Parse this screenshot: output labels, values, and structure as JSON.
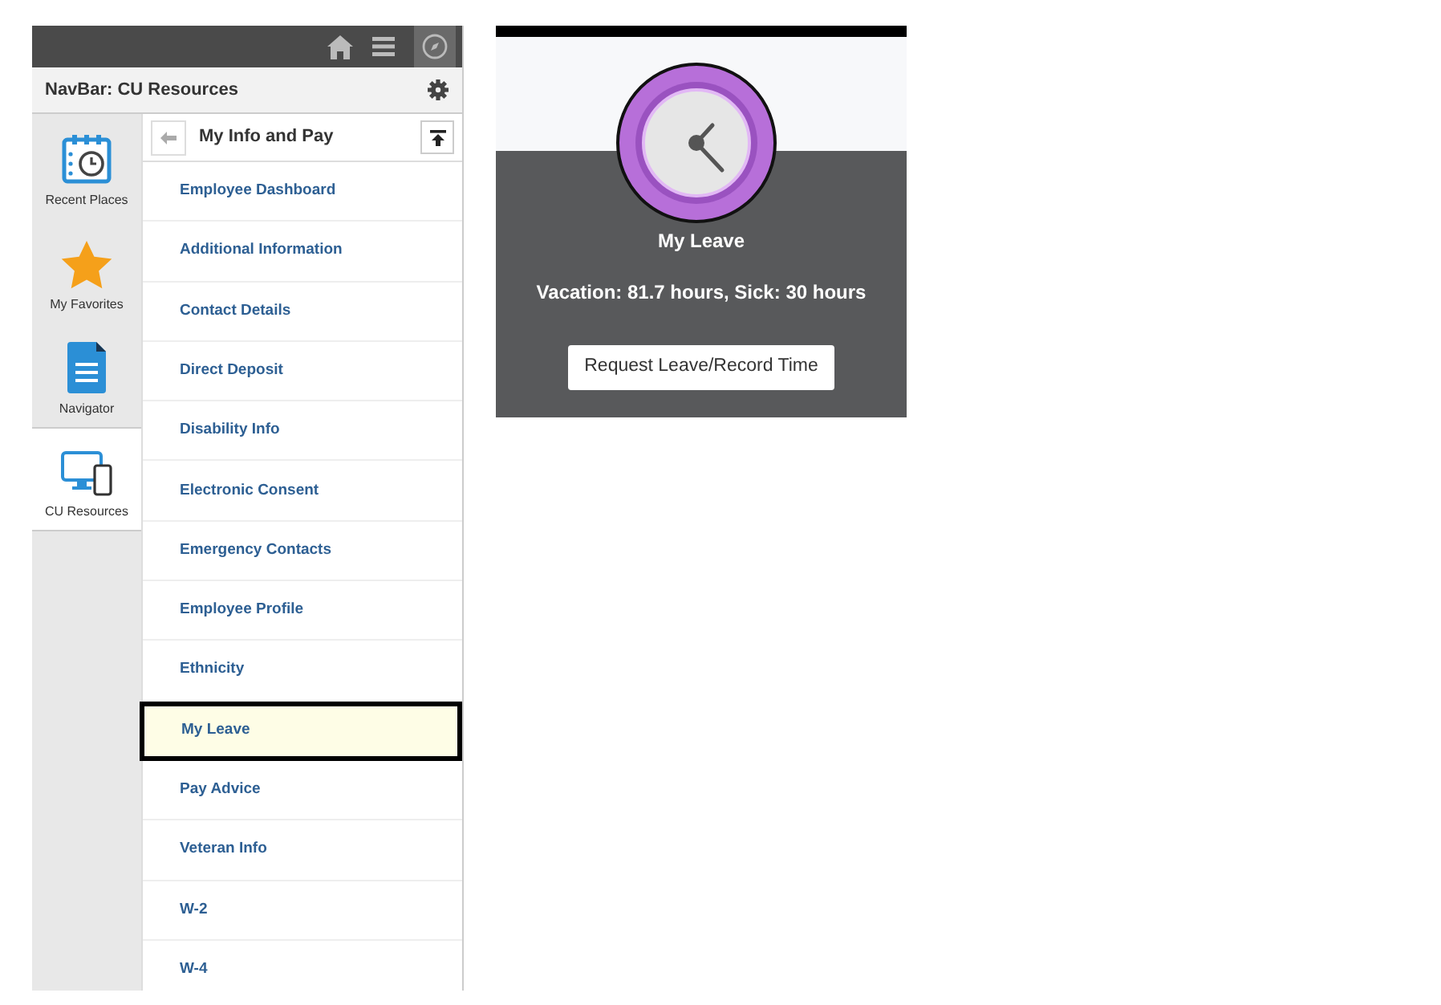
{
  "navbar": {
    "title": "NavBar: CU Resources"
  },
  "rail": [
    {
      "label": "Recent Places",
      "kind": "recent",
      "selected": false
    },
    {
      "label": "My Favorites",
      "kind": "favorites",
      "selected": false
    },
    {
      "label": "Navigator",
      "kind": "navigator",
      "selected": false
    },
    {
      "label": "CU Resources",
      "kind": "resources",
      "selected": true
    }
  ],
  "menu": {
    "title": "My Info and Pay",
    "items": [
      {
        "label": "Employee Dashboard",
        "selected": false
      },
      {
        "label": "Additional Information",
        "selected": false
      },
      {
        "label": "Contact Details",
        "selected": false
      },
      {
        "label": "Direct Deposit",
        "selected": false
      },
      {
        "label": "Disability Info",
        "selected": false
      },
      {
        "label": "Electronic Consent",
        "selected": false
      },
      {
        "label": "Emergency Contacts",
        "selected": false
      },
      {
        "label": "Employee Profile",
        "selected": false
      },
      {
        "label": "Ethnicity",
        "selected": false
      },
      {
        "label": "My Leave",
        "selected": true
      },
      {
        "label": "Pay Advice",
        "selected": false
      },
      {
        "label": "Veteran Info",
        "selected": false
      },
      {
        "label": "W-2",
        "selected": false
      },
      {
        "label": "W-4",
        "selected": false
      }
    ]
  },
  "tile": {
    "title": "My Leave",
    "summary": "Vacation: 81.7 hours, Sick: 30 hours",
    "button": "Request Leave/Record Time"
  }
}
